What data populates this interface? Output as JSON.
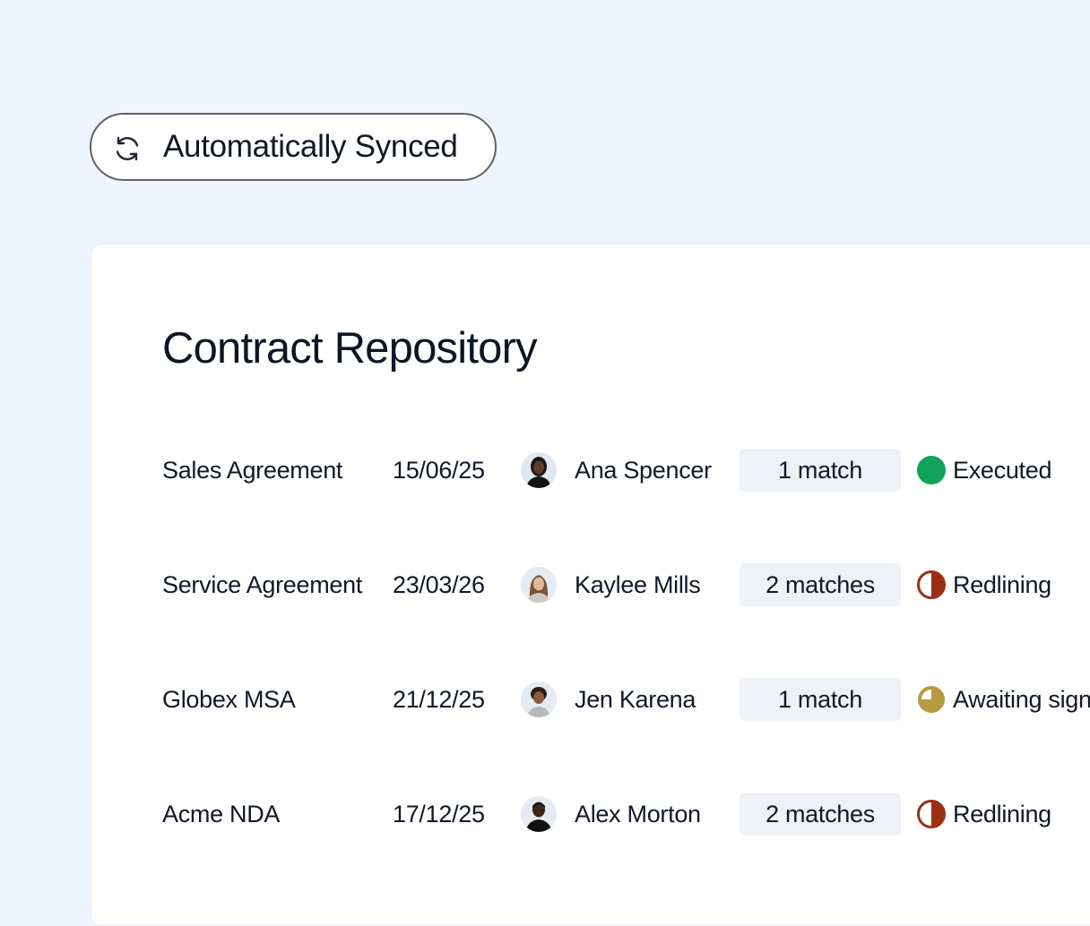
{
  "sync_badge": {
    "icon": "sync-icon",
    "label": "Automatically Synced"
  },
  "repository": {
    "title": "Contract Repository",
    "rows": [
      {
        "name": "Sales Agreement",
        "date": "15/06/25",
        "owner": "Ana Spencer",
        "matches": "1 match",
        "status": "Executed",
        "status_icon": "status-executed-icon",
        "status_color": "#0fa35a"
      },
      {
        "name": "Service Agreement",
        "date": "23/03/26",
        "owner": "Kaylee Mills",
        "matches": "2 matches",
        "status": "Redlining",
        "status_icon": "status-redlining-icon",
        "status_color": "#9a2f14"
      },
      {
        "name": "Globex MSA",
        "date": "21/12/25",
        "owner": "Jen Karena",
        "matches": "1 match",
        "status": "Awaiting sign",
        "status_icon": "status-awaiting-icon",
        "status_color": "#b79a3f"
      },
      {
        "name": "Acme NDA",
        "date": "17/12/25",
        "owner": "Alex Morton",
        "matches": "2 matches",
        "status": "Redlining",
        "status_icon": "status-redlining-icon",
        "status_color": "#9a2f14"
      }
    ]
  }
}
